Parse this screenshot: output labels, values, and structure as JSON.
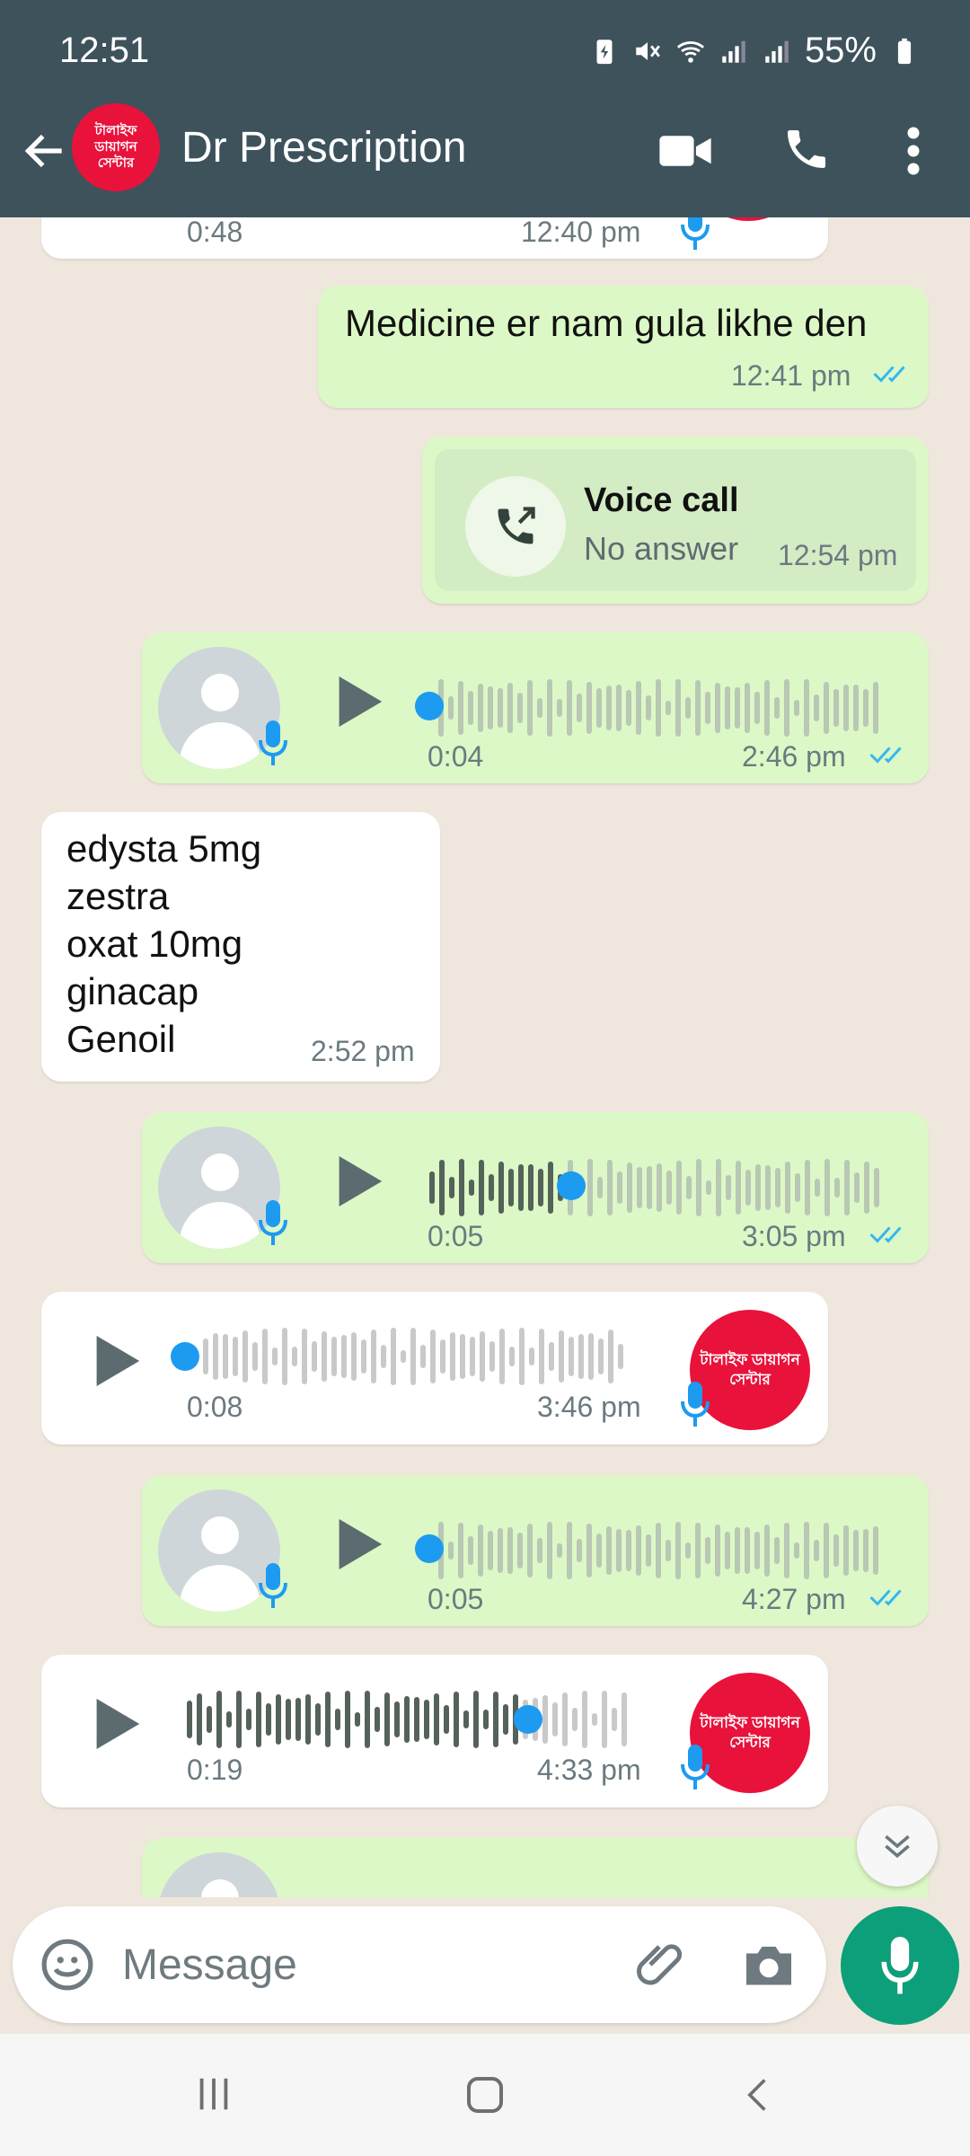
{
  "status_bar": {
    "time": "12:51",
    "battery": "55%"
  },
  "header": {
    "contact_name": "Dr Prescription",
    "avatar_text_line1": "টালাইফ ডায়াগন",
    "avatar_text_line2": "সেন্টার"
  },
  "messages": {
    "m0": {
      "duration": "0:48",
      "time": "12:40 pm"
    },
    "m1": {
      "text": "Medicine er nam gula likhe den",
      "time": "12:41 pm"
    },
    "m2": {
      "title": "Voice call",
      "subtitle": "No answer",
      "time": "12:54 pm"
    },
    "m3": {
      "duration": "0:04",
      "time": "2:46 pm",
      "progress": 0
    },
    "m4": {
      "lines": [
        "edysta 5mg",
        "zestra",
        "oxat 10mg",
        "ginacap",
        "Genoil"
      ],
      "time": "2:52 pm"
    },
    "m5": {
      "duration": "0:05",
      "time": "3:05 pm",
      "progress": 0.3
    },
    "m6": {
      "duration": "0:08",
      "time": "3:46 pm",
      "avatar_line1": "টালাইফ ডায়াগন",
      "avatar_line2": "সেন্টার",
      "progress": 0
    },
    "m7": {
      "duration": "0:05",
      "time": "4:27 pm",
      "progress": 0
    },
    "m8": {
      "duration": "0:19",
      "time": "4:33 pm",
      "avatar_line1": "টালাইফ ডায়াগন",
      "avatar_line2": "সেন্টার",
      "progress": 0.75
    }
  },
  "input": {
    "placeholder": "Message"
  },
  "colors": {
    "header": "#3e525c",
    "outgoing": "#dcf8c6",
    "incoming": "#ffffff",
    "accent": "#0d9f79",
    "read_ticks": "#34b7f1",
    "brand_red": "#e8123b"
  },
  "icons": [
    "back-arrow-icon",
    "video-call-icon",
    "phone-icon",
    "more-vert-icon",
    "emoji-icon",
    "attach-icon",
    "camera-icon",
    "mic-icon",
    "play-icon",
    "scroll-down-icon"
  ]
}
